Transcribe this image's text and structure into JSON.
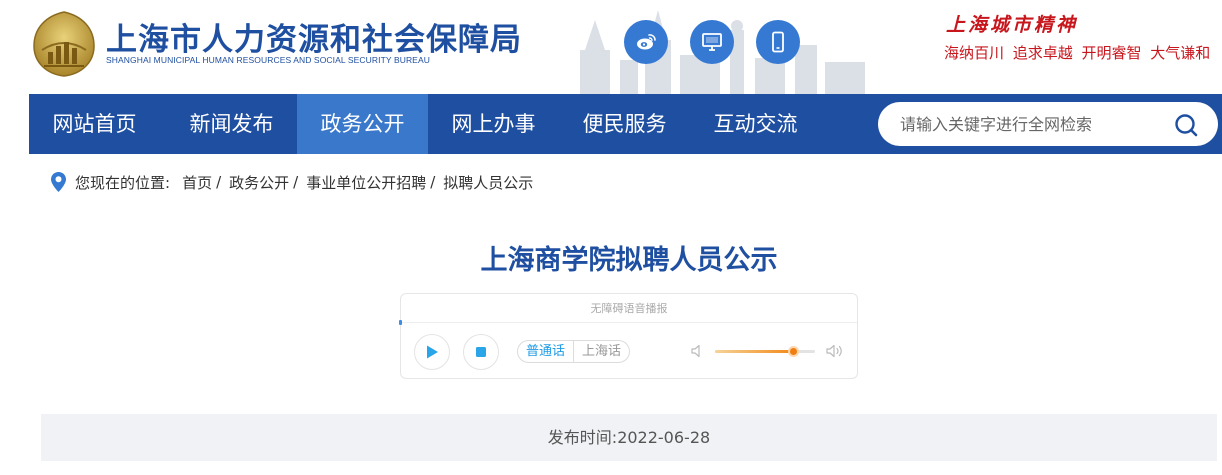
{
  "header": {
    "org_name_cn": "上海市人力资源和社会保障局",
    "org_name_en": "SHANGHAI MUNICIPAL HUMAN RESOURCES AND SOCIAL SECURITY BUREAU",
    "social_icons": [
      "weibo-icon",
      "desktop-icon",
      "mobile-icon"
    ],
    "spirit_title": "上海城市精神",
    "spirit_words": "海纳百川 追求卓越 开明睿智 大气谦和"
  },
  "nav": {
    "items": [
      {
        "label": "网站首页",
        "active": false
      },
      {
        "label": "新闻发布",
        "active": false
      },
      {
        "label": "政务公开",
        "active": true
      },
      {
        "label": "网上办事",
        "active": false
      },
      {
        "label": "便民服务",
        "active": false
      },
      {
        "label": "互动交流",
        "active": false
      }
    ],
    "search_placeholder": "请输入关键字进行全网检索"
  },
  "breadcrumb": {
    "prefix": "您现在的位置:",
    "items": [
      "首页",
      "政务公开",
      "事业单位公开招聘",
      "拟聘人员公示"
    ],
    "separator": "/"
  },
  "article": {
    "title": "上海商学院拟聘人员公示",
    "publish_time": "发布时间:2022-06-28"
  },
  "player": {
    "title": "无障碍语音播报",
    "languages": [
      {
        "label": "普通话",
        "active": true
      },
      {
        "label": "上海话",
        "active": false
      }
    ],
    "volume": 0.78
  },
  "colors": {
    "brand_blue": "#1f4fa0",
    "nav_active": "#3a78cc",
    "social_blue": "#3679d3",
    "spirit_red": "#c8161d",
    "volume_orange": "#f07f12"
  }
}
